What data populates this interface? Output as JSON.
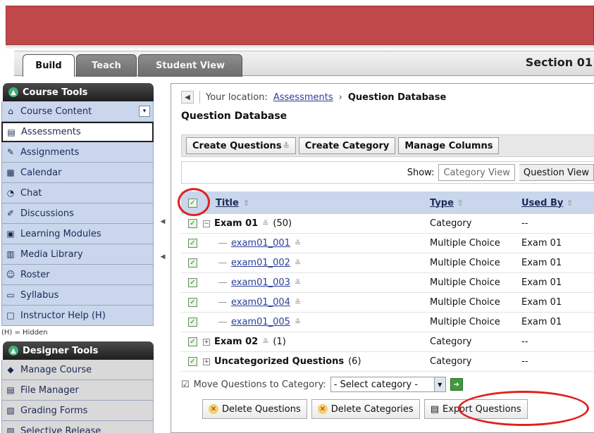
{
  "tabs": [
    {
      "label": "Build"
    },
    {
      "label": "Teach"
    },
    {
      "label": "Student View"
    }
  ],
  "section_title": "Section 01",
  "course_tools": {
    "header": "Course Tools",
    "items": [
      {
        "label": "Course Content",
        "icon": "home-icon"
      },
      {
        "label": "Assessments",
        "icon": "assessment-icon"
      },
      {
        "label": "Assignments",
        "icon": "assignment-icon"
      },
      {
        "label": "Calendar",
        "icon": "calendar-icon"
      },
      {
        "label": "Chat",
        "icon": "chat-icon"
      },
      {
        "label": "Discussions",
        "icon": "discussion-icon"
      },
      {
        "label": "Learning Modules",
        "icon": "modules-icon"
      },
      {
        "label": "Media Library",
        "icon": "media-icon"
      },
      {
        "label": "Roster",
        "icon": "roster-icon"
      },
      {
        "label": "Syllabus",
        "icon": "syllabus-icon"
      },
      {
        "label": "Instructor Help (H)",
        "icon": "blank-icon"
      }
    ],
    "hidden_note": "(H) = Hidden"
  },
  "designer_tools": {
    "header": "Designer Tools",
    "items": [
      {
        "label": "Manage Course",
        "icon": "manage-icon"
      },
      {
        "label": "File Manager",
        "icon": "file-icon"
      },
      {
        "label": "Grading Forms",
        "icon": "grading-icon"
      },
      {
        "label": "Selective Release",
        "icon": "release-icon"
      }
    ]
  },
  "location": {
    "prefix": "Your location:",
    "link": "Assessments",
    "current": "Question Database"
  },
  "page_title": "Question Database",
  "toolbar": {
    "create_questions": "Create Questions",
    "create_category": "Create Category",
    "manage_columns": "Manage Columns"
  },
  "show": {
    "label": "Show:",
    "category_view": "Category View",
    "question_view": "Question View"
  },
  "grid": {
    "headers": {
      "title": "Title",
      "type": "Type",
      "used_by": "Used By"
    },
    "rows": [
      {
        "title": "Exam 01",
        "count": "(50)",
        "type": "Category",
        "used_by": "--",
        "kind": "category",
        "expanded": true
      },
      {
        "title": "exam01_001",
        "type": "Multiple Choice",
        "used_by": "Exam 01",
        "kind": "question"
      },
      {
        "title": "exam01_002",
        "type": "Multiple Choice",
        "used_by": "Exam 01",
        "kind": "question"
      },
      {
        "title": "exam01_003",
        "type": "Multiple Choice",
        "used_by": "Exam 01",
        "kind": "question"
      },
      {
        "title": "exam01_004",
        "type": "Multiple Choice",
        "used_by": "Exam 01",
        "kind": "question"
      },
      {
        "title": "exam01_005",
        "type": "Multiple Choice",
        "used_by": "Exam 01",
        "kind": "question"
      },
      {
        "title": "Exam 02",
        "count": "(1)",
        "type": "Category",
        "used_by": "--",
        "kind": "category",
        "expanded": false
      },
      {
        "title": "Uncategorized Questions",
        "count": "(6)",
        "type": "Category",
        "used_by": "--",
        "kind": "category",
        "expanded": false
      }
    ]
  },
  "move": {
    "label": "Move Questions to Category:",
    "select_value": "- Select category -"
  },
  "actions": {
    "delete_questions": "Delete Questions",
    "delete_categories": "Delete Categories",
    "export_questions": "Export Questions"
  },
  "colors": {
    "banner": "#c0474a",
    "highlight_circle": "#e02020",
    "sidebar_item": "#c9d6ec"
  }
}
